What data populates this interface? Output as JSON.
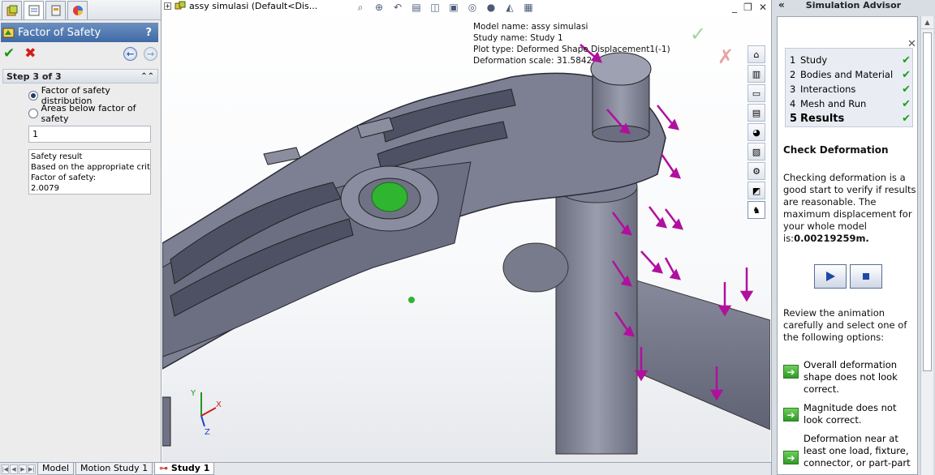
{
  "left_panel": {
    "title": "Factor of Safety",
    "help": "?",
    "step": "Step 3 of 3",
    "radio_distribution": "Factor of safety distribution",
    "radio_areas": "Areas below factor of safety",
    "input_value": "1",
    "result_lines": [
      "Safety result",
      "Based on the appropriate crite",
      "Factor of safety:",
      "2.0079"
    ]
  },
  "viewport": {
    "tree_label": "assy simulasi  (Default<Dis...",
    "info": [
      "Model name: assy simulasi",
      "Study name: Study 1",
      "Plot type: Deformed Shape Displacement1(-1)",
      "Deformation scale: 31.5842"
    ],
    "triad": {
      "x": "X",
      "y": "Y",
      "z": "Z"
    }
  },
  "right_panel": {
    "title": "Simulation Advisor",
    "steps": [
      {
        "num": "1",
        "label": "Study"
      },
      {
        "num": "2",
        "label": "Bodies and Material"
      },
      {
        "num": "3",
        "label": "Interactions"
      },
      {
        "num": "4",
        "label": "Mesh and Run"
      },
      {
        "num": "5",
        "label": "Results"
      }
    ],
    "heading": "Check Deformation",
    "para": "Checking deformation is a good start to verify if results are reasonable. The maximum displacement for your whole model is:",
    "max_disp": "0.00219259m.",
    "review": "Review the animation carefully and select one of the following options:",
    "options": [
      "Overall deformation shape does not look correct.",
      "Magnitude does not look correct.",
      "Deformation near at least one load, fixture, connector, or part-part"
    ]
  },
  "bottom_tabs": [
    "Model",
    "Motion Study 1",
    "Study 1"
  ]
}
